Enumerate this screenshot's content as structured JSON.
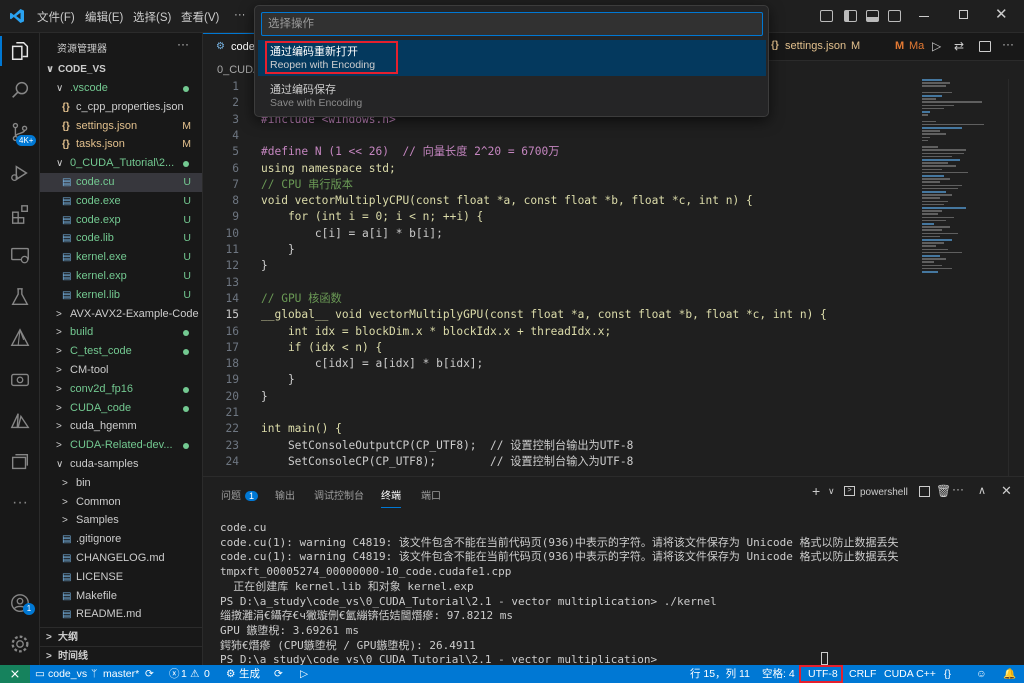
{
  "menu": {
    "file": "文件(F)",
    "edit": "编辑(E)",
    "select": "选择(S)",
    "view": "查看(V)",
    "more": "···"
  },
  "activity": {
    "badge": "4K+",
    "account_badge": "1"
  },
  "explorer": {
    "title": "资源管理器",
    "more": "···",
    "root": "CODE_VS",
    "items": [
      {
        "label": ".vscode",
        "status": "dot",
        "indent": 1,
        "type": "folder-open"
      },
      {
        "label": "c_cpp_properties.json",
        "status": "",
        "indent": 2,
        "type": "json"
      },
      {
        "label": "settings.json",
        "status": "M",
        "indent": 2,
        "type": "json"
      },
      {
        "label": "tasks.json",
        "status": "M",
        "indent": 2,
        "type": "json"
      },
      {
        "label": "0_CUDA_Tutorial\\2...",
        "status": "dot",
        "indent": 1,
        "type": "folder-open"
      },
      {
        "label": "code.cu",
        "status": "U",
        "indent": 2,
        "type": "file",
        "selected": true
      },
      {
        "label": "code.exe",
        "status": "U",
        "indent": 2,
        "type": "file"
      },
      {
        "label": "code.exp",
        "status": "U",
        "indent": 2,
        "type": "file"
      },
      {
        "label": "code.lib",
        "status": "U",
        "indent": 2,
        "type": "file"
      },
      {
        "label": "kernel.exe",
        "status": "U",
        "indent": 2,
        "type": "file"
      },
      {
        "label": "kernel.exp",
        "status": "U",
        "indent": 2,
        "type": "file"
      },
      {
        "label": "kernel.lib",
        "status": "U",
        "indent": 2,
        "type": "file"
      },
      {
        "label": "AVX-AVX2-Example-Code",
        "status": "",
        "indent": 1,
        "type": "folder"
      },
      {
        "label": "build",
        "status": "dot",
        "indent": 1,
        "type": "folder"
      },
      {
        "label": "C_test_code",
        "status": "dot",
        "indent": 1,
        "type": "folder"
      },
      {
        "label": "CM-tool",
        "status": "",
        "indent": 1,
        "type": "folder"
      },
      {
        "label": "conv2d_fp16",
        "status": "dot",
        "indent": 1,
        "type": "folder"
      },
      {
        "label": "CUDA_code",
        "status": "dot",
        "indent": 1,
        "type": "folder"
      },
      {
        "label": "cuda_hgemm",
        "status": "",
        "indent": 1,
        "type": "folder"
      },
      {
        "label": "CUDA-Related-dev...",
        "status": "dot",
        "indent": 1,
        "type": "folder"
      },
      {
        "label": "cuda-samples",
        "status": "",
        "indent": 1,
        "type": "folder-open"
      },
      {
        "label": "bin",
        "status": "",
        "indent": 2,
        "type": "folder"
      },
      {
        "label": "Common",
        "status": "",
        "indent": 2,
        "type": "folder"
      },
      {
        "label": "Samples",
        "status": "",
        "indent": 2,
        "type": "folder"
      },
      {
        "label": ".gitignore",
        "status": "",
        "indent": 2,
        "type": "file"
      },
      {
        "label": "CHANGELOG.md",
        "status": "",
        "indent": 2,
        "type": "file"
      },
      {
        "label": "LICENSE",
        "status": "",
        "indent": 2,
        "type": "file"
      },
      {
        "label": "Makefile",
        "status": "",
        "indent": 2,
        "type": "file"
      },
      {
        "label": "README.md",
        "status": "",
        "indent": 2,
        "type": "file"
      }
    ],
    "outline": "大纲",
    "timeline": "时间线"
  },
  "tabs": {
    "code_tab": "code",
    "settings_tab": "settings.json",
    "settings_status": "M",
    "ma_tab": "Ma"
  },
  "breadcrumb": "0_CUDA",
  "quickpick": {
    "placeholder": "选择操作",
    "items": [
      {
        "title": "通过编码重新打开",
        "subtitle": "Reopen with Encoding"
      },
      {
        "title": "通过编码保存",
        "subtitle": "Save with Encoding"
      }
    ]
  },
  "code": [
    {
      "n": "1",
      "t": ""
    },
    {
      "n": "2",
      "t": "#include <cuda_runtime.h>"
    },
    {
      "n": "3",
      "t": "#include <windows.h>"
    },
    {
      "n": "4",
      "t": ""
    },
    {
      "n": "5",
      "t": "#define N (1 << 26)  // 向量长度 2^20 = 6700万"
    },
    {
      "n": "6",
      "t": "using namespace std;"
    },
    {
      "n": "7",
      "t": "// CPU 串行版本"
    },
    {
      "n": "8",
      "t": "void vectorMultiplyCPU(const float *a, const float *b, float *c, int n) {"
    },
    {
      "n": "9",
      "t": "    for (int i = 0; i < n; ++i) {"
    },
    {
      "n": "10",
      "t": "        c[i] = a[i] * b[i];"
    },
    {
      "n": "11",
      "t": "    }"
    },
    {
      "n": "12",
      "t": "}"
    },
    {
      "n": "13",
      "t": ""
    },
    {
      "n": "14",
      "t": "// GPU 核函数"
    },
    {
      "n": "15",
      "t": "__global__ void vectorMultiplyGPU(const float *a, const float *b, float *c, int n) {"
    },
    {
      "n": "16",
      "t": "    int idx = blockDim.x * blockIdx.x + threadIdx.x;"
    },
    {
      "n": "17",
      "t": "    if (idx < n) {"
    },
    {
      "n": "18",
      "t": "        c[idx] = a[idx] * b[idx];"
    },
    {
      "n": "19",
      "t": "    }"
    },
    {
      "n": "20",
      "t": "}"
    },
    {
      "n": "21",
      "t": ""
    },
    {
      "n": "22",
      "t": "int main() {"
    },
    {
      "n": "23",
      "t": "    SetConsoleOutputCP(CP_UTF8);  // 设置控制台输出为UTF-8"
    },
    {
      "n": "24",
      "t": "    SetConsoleCP(CP_UTF8);        // 设置控制台输入为UTF-8"
    }
  ],
  "panel": {
    "tabs": [
      {
        "label": "问题",
        "badge": "1"
      },
      {
        "label": "输出"
      },
      {
        "label": "调试控制台"
      },
      {
        "label": "终端",
        "active": true
      },
      {
        "label": "端口"
      }
    ],
    "shell": "powershell",
    "terminal": [
      "code.cu",
      "code.cu(1): warning C4819: 该文件包含不能在当前代码页(936)中表示的字符。请将该文件保存为 Unicode 格式以防止数据丢失",
      "code.cu(1): warning C4819: 该文件包含不能在当前代码页(936)中表示的字符。请将该文件保存为 Unicode 格式以防止数据丢失",
      "tmpxft_00005274_00000000-10_code.cudafe1.cpp",
      "  正在创建库 kernel.lib 和对象 kernel.exp",
      "PS D:\\a_study\\code_vs\\0_CUDA_Tutorial\\2.1 - vector multiplication> ./kernel",
      "缁撴灉涓€鑷存€ч獙璇侀€氳繃锛佸姞閫熸瘮: 97.8212 ms",
      "GPU 鏃堕棿: 3.69261 ms",
      "鍔犻€熸瘮 (CPU鏃堕棿 / GPU鏃堕棿): 26.4911",
      "PS D:\\a_study\\code_vs\\0_CUDA_Tutorial\\2.1 - vector multiplication> "
    ]
  },
  "status": {
    "remote": "⨯",
    "workspace": "code_vs",
    "branch": "master*",
    "errors": "1",
    "warnings": "0",
    "build": "生成",
    "position": "行 15，列 11",
    "spaces": "空格: 4",
    "encoding": "UTF-8",
    "eol": "CRLF",
    "language": "CUDA C++"
  },
  "colors": {
    "accent": "#0078d4",
    "highlight": "#e5202e",
    "modified": "#e2c08d",
    "untracked": "#73c991"
  }
}
